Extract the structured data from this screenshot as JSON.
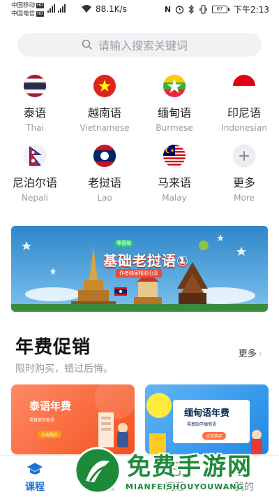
{
  "status_bar": {
    "carrier1": "中国移动",
    "carrier2": "中国电信",
    "hd": "HD",
    "speed": "88.1K/s",
    "battery": "67",
    "time": "下午2:13"
  },
  "search": {
    "placeholder": "请输入搜索关键词",
    "icon": "search-icon"
  },
  "languages": [
    {
      "zh": "泰语",
      "en": "Thai",
      "flag": "thailand-flag-icon"
    },
    {
      "zh": "越南语",
      "en": "Vietnamese",
      "flag": "vietnam-flag-icon"
    },
    {
      "zh": "缅甸语",
      "en": "Burmese",
      "flag": "myanmar-flag-icon"
    },
    {
      "zh": "印尼语",
      "en": "Indonesian",
      "flag": "indonesia-flag-icon"
    },
    {
      "zh": "尼泊尔语",
      "en": "Nepali",
      "flag": "nepal-flag-icon"
    },
    {
      "zh": "老挝语",
      "en": "Lao",
      "flag": "laos-flag-icon"
    },
    {
      "zh": "马来语",
      "en": "Malay",
      "flag": "malaysia-flag-icon"
    },
    {
      "zh": "更多",
      "en": "More",
      "flag": "plus-icon"
    }
  ],
  "banner": {
    "title": "基础老挝语①",
    "tag": "零基础",
    "subtitle": "作者独家精彩分享"
  },
  "promotion": {
    "title": "年费促销",
    "subtitle": "限时购买，错过后悔。",
    "more": "更多",
    "cards": [
      {
        "title": "泰语年费",
        "desc": "零基础学泰语",
        "button": "点击购买"
      },
      {
        "title": "缅甸语年费",
        "desc": "零基础学缅甸语",
        "button": "点击购买"
      }
    ]
  },
  "tabs": [
    {
      "label": "课程",
      "icon": "graduation-cap-icon",
      "active": true
    },
    {
      "label": "音频",
      "icon": "headphones-icon",
      "active": false
    },
    {
      "label": "词汇",
      "icon": "book-icon",
      "active": false
    },
    {
      "label": "我的",
      "icon": "user-icon",
      "active": false
    }
  ],
  "watermark": {
    "text": "免费手游网",
    "sub": "MIANFEISHOUYOUWANG"
  },
  "colors": {
    "accent": "#1e73d2",
    "watermark": "#1d8a3a"
  }
}
